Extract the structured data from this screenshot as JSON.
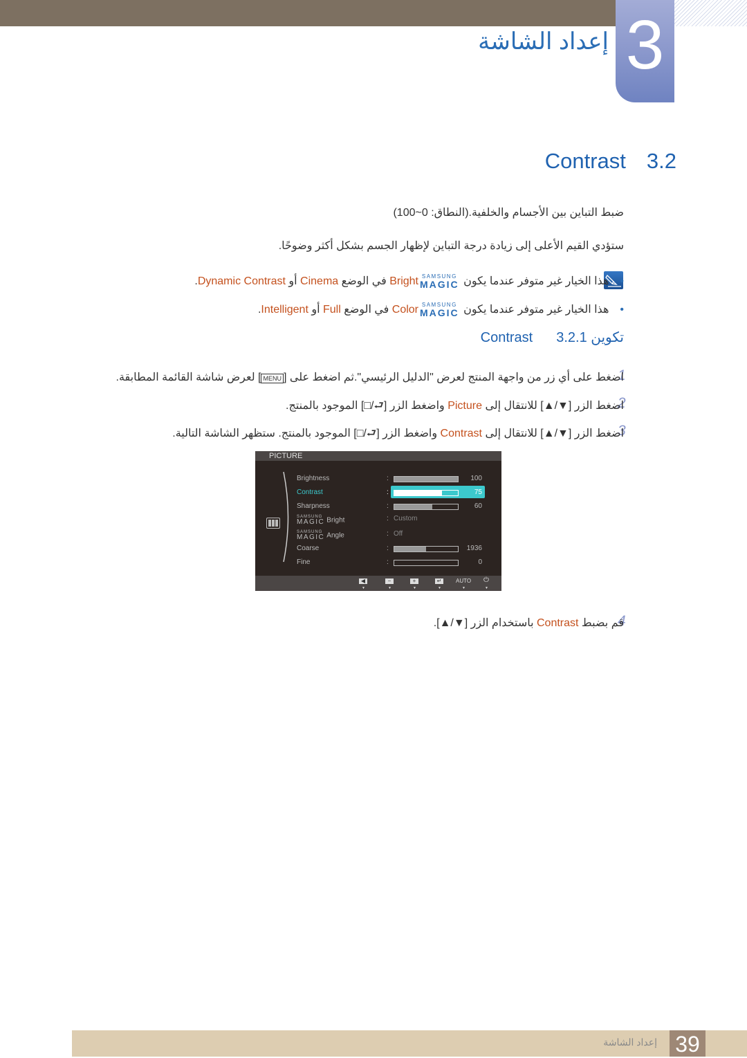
{
  "chapter": {
    "number": "3",
    "title": "إعداد الشاشة"
  },
  "section": {
    "number": "3.2",
    "title": "Contrast"
  },
  "intro": {
    "line1": "ضبط التباين بين الأجسام والخلفية.(النطاق: 0~100)",
    "line2": "ستؤدي القيم الأعلى إلى زيادة درجة التباين لإظهار الجسم بشكل أكثر وضوحًا."
  },
  "notes": [
    {
      "prefix": "هذا الخيار غير متوفر عندما يكون ",
      "magic_top": "SAMSUNG",
      "magic_bottom": "MAGIC",
      "feature": "Bright",
      "mid": " في الوضع ",
      "opt1": "Cinema",
      "or": " أو ",
      "opt2": "Dynamic Contrast",
      "end": "."
    },
    {
      "prefix": "هذا الخيار غير متوفر عندما يكون ",
      "magic_top": "SAMSUNG",
      "magic_bottom": "MAGIC",
      "feature": "Color",
      "mid": " في الوضع ",
      "opt1": "Full",
      "or": " أو ",
      "opt2": "Intelligent",
      "end": "."
    }
  ],
  "subsection": {
    "number": "3.2.1",
    "title": "تكوين Contrast"
  },
  "steps": [
    {
      "num": "1",
      "a": "اضغط على أي زر من واجهة المنتج لعرض \"الدليل الرئيسي\".ثم اضغط على [",
      "key": "MENU",
      "b": "] لعرض شاشة القائمة المطابقة."
    },
    {
      "num": "2",
      "a": "اضغط الزر [▼/▲] للانتقال إلى ",
      "hl": "Picture",
      "b": " واضغط الزر [⮐/□] الموجود بالمنتج."
    },
    {
      "num": "3",
      "a": "اضغط الزر [▼/▲] للانتقال إلى ",
      "hl": "Contrast",
      "b": " واضغط الزر [⮐/□] الموجود بالمنتج. ستظهر الشاشة التالية."
    },
    {
      "num": "4",
      "a": "قم بضبط ",
      "hl": "Contrast",
      "b": " باستخدام الزر [▼/▲]."
    }
  ],
  "osd": {
    "title": "PICTURE",
    "rows": [
      {
        "label": "Brightness",
        "value": "100",
        "level": 1.0
      },
      {
        "label": "Contrast",
        "value": "75",
        "level": 0.75,
        "selected": true
      },
      {
        "label": "Sharpness",
        "value": "60",
        "level": 0.6
      },
      {
        "magic": true,
        "magic_top": "SAMSUNG",
        "magic_bottom": "MAGIC",
        "label": "Bright",
        "text_value": "Custom"
      },
      {
        "magic": true,
        "magic_top": "SAMSUNG",
        "magic_bottom": "MAGIC",
        "label": "Angle",
        "text_value": "Off"
      },
      {
        "label": "Coarse",
        "value": "1936",
        "level": 0.5
      },
      {
        "label": "Fine",
        "value": "0",
        "level": 0.0
      }
    ],
    "buttons": [
      "◀",
      "−",
      "+",
      "↵",
      "AUTO",
      "⏻"
    ]
  },
  "footer": {
    "page": "39",
    "title": "إعداد الشاشة"
  },
  "colors": {
    "accent_blue": "#1f62b0",
    "highlight_orange": "#c4511e",
    "osd_highlight": "#3cc9cd"
  }
}
